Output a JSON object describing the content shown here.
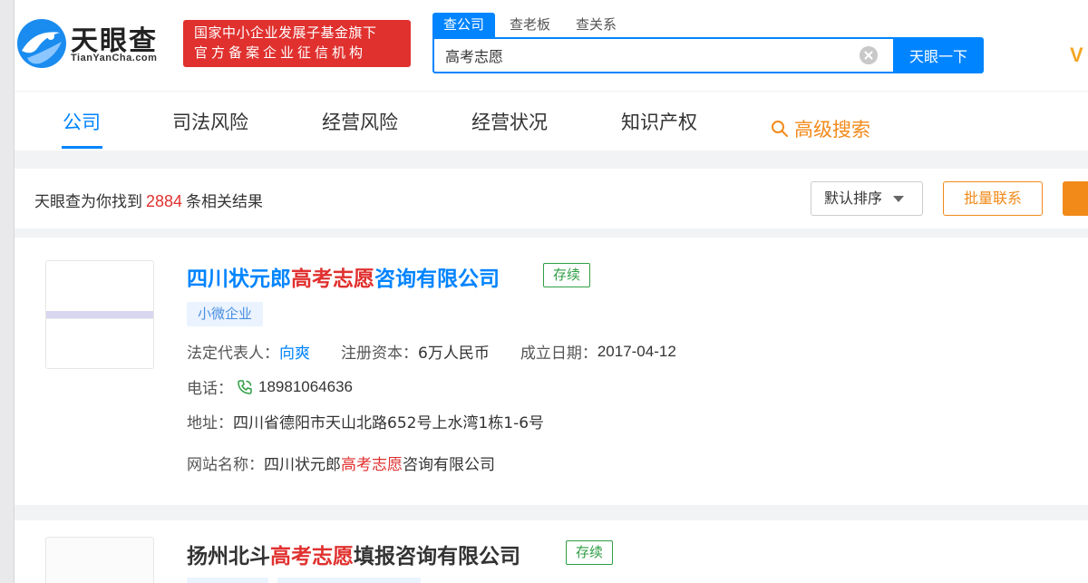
{
  "header": {
    "brand_cn": "天眼查",
    "brand_en": "TianYanCha.com",
    "badge_line1": "国家中小企业发展子基金旗下",
    "badge_line2": "官方备案企业征信机构",
    "search_tabs": [
      "查公司",
      "查老板",
      "查关系"
    ],
    "search_value": "高考志愿",
    "search_button": "天眼一下",
    "vip_partial": "V"
  },
  "nav": {
    "items": [
      "公司",
      "司法风险",
      "经营风险",
      "经营状况",
      "知识产权"
    ],
    "advanced": "高级搜索"
  },
  "summary": {
    "prefix": "天眼查为你找到",
    "count": "2884",
    "suffix": "条相关结果",
    "sort_label": "默认排序",
    "bulk_button": "批量联系"
  },
  "results": [
    {
      "name_prefix": "四川状元郎",
      "name_highlight": "高考志愿",
      "name_suffix": "咨询有限公司",
      "status": "存续",
      "tag": "小微企业",
      "legal_rep_label": "法定代表人：",
      "legal_rep": "向爽",
      "capital_label": "注册资本：",
      "capital": "6万人民币",
      "founded_label": "成立日期：",
      "founded": "2017-04-12",
      "phone_label": "电话：",
      "phone": "18981064636",
      "address_label": "地址：",
      "address": "四川省德阳市天山北路652号上水湾1栋1-6号",
      "website_label": "网站名称：",
      "website_prefix": "四川状元郎",
      "website_highlight": "高考志愿",
      "website_suffix": "咨询有限公司"
    },
    {
      "name_prefix": "扬州北斗",
      "name_highlight": "高考志愿",
      "name_suffix": "填报咨询有限公司",
      "status": "存续"
    }
  ],
  "colors": {
    "primary": "#0084ff",
    "highlight": "#e0312f",
    "status_green": "#2f9e44",
    "accent_orange": "#f28a1a"
  }
}
